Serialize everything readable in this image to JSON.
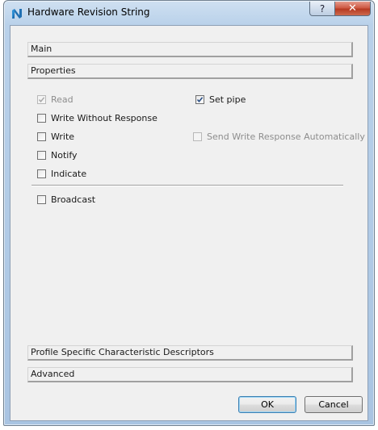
{
  "window": {
    "title": "Hardware Revision String",
    "help_glyph": "?",
    "close_glyph": "✕",
    "app_icon": "nordic-n-icon"
  },
  "sections": {
    "main": "Main",
    "properties": "Properties",
    "profile_descriptors": "Profile Specific Characteristic Descriptors",
    "advanced": "Advanced"
  },
  "properties": {
    "read": {
      "label": "Read",
      "checked": true,
      "enabled": false
    },
    "write_without_response": {
      "label": "Write Without Response",
      "checked": false,
      "enabled": true
    },
    "write": {
      "label": "Write",
      "checked": false,
      "enabled": true
    },
    "notify": {
      "label": "Notify",
      "checked": false,
      "enabled": true
    },
    "indicate": {
      "label": "Indicate",
      "checked": false,
      "enabled": true
    },
    "set_pipe": {
      "label": "Set pipe",
      "checked": true,
      "enabled": true
    },
    "send_write_response": {
      "label": "Send Write Response Automatically",
      "checked": false,
      "enabled": false
    },
    "broadcast": {
      "label": "Broadcast",
      "checked": false,
      "enabled": true
    }
  },
  "buttons": {
    "ok": "OK",
    "cancel": "Cancel"
  },
  "colors": {
    "titlebar": "#b9d1ea",
    "close_button": "#c7492f",
    "dialog_bg": "#f0f0f0",
    "default_button_border": "#3c7fb1"
  }
}
